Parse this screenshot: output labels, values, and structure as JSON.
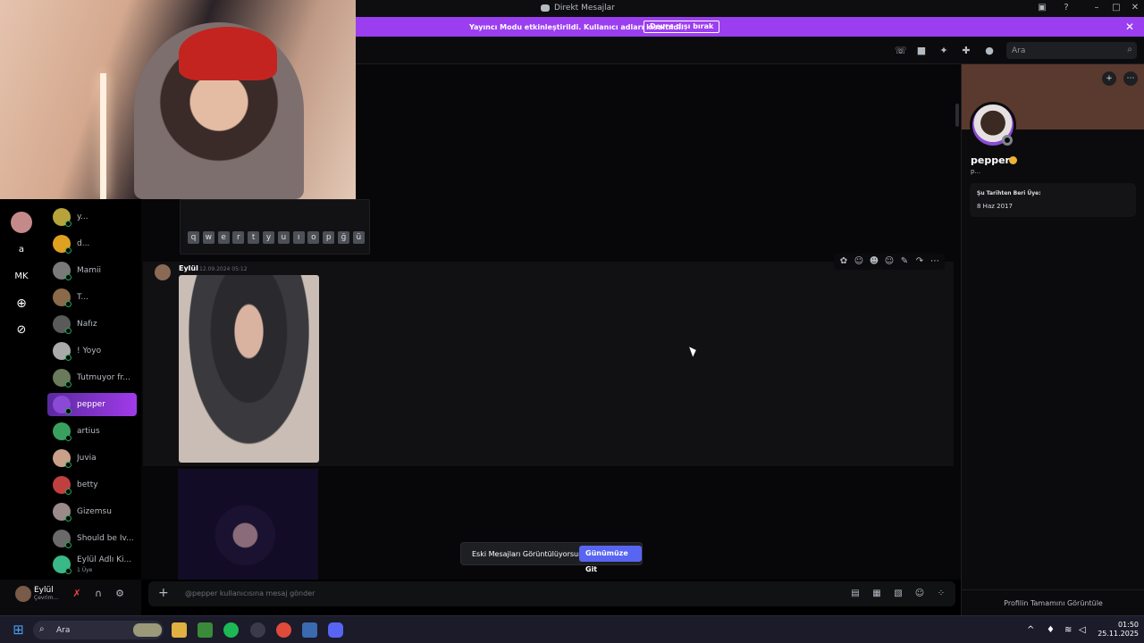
{
  "window": {
    "title": "Direkt Mesajlar"
  },
  "banner": {
    "text": "Yayıncı Modu etkinleştirildi. Kullanıcı adları kısaltıldı.",
    "button": "Devre dışı bırak"
  },
  "toolbar": {
    "search_placeholder": "Ara"
  },
  "servers": [
    {
      "label": "a"
    },
    {
      "label": "MK"
    }
  ],
  "dms": [
    {
      "name": "y...",
      "color": "#b8a23a"
    },
    {
      "name": "d...",
      "color": "#e0a020"
    },
    {
      "name": "Mamii",
      "color": "#7a7a7a"
    },
    {
      "name": "T...",
      "color": "#8a6a4a"
    },
    {
      "name": "Nafız",
      "color": "#5a5a5a"
    },
    {
      "name": "! Yoyo",
      "color": "#aaaaaa"
    },
    {
      "name": "Tutmuyor fr...",
      "color": "#6a7a5a"
    },
    {
      "name": "pepper",
      "color": "#8a4ad6",
      "active": true
    },
    {
      "name": "artius",
      "color": "#3aa060"
    },
    {
      "name": "Juvia",
      "color": "#c9a08a"
    },
    {
      "name": "betty",
      "color": "#c04040"
    },
    {
      "name": "Gizemsu",
      "color": "#9a8a8a"
    },
    {
      "name": "Should be Iv...",
      "color": "#6a6a6a"
    },
    {
      "name": "Eylül Adlı Ki...",
      "sub": "1 Üye",
      "color": "#3ab888"
    }
  ],
  "user": {
    "name": "Eylül",
    "status": "Çevrim..."
  },
  "keyboard": {
    "keys": [
      "q",
      "w",
      "e",
      "r",
      "t",
      "y",
      "u",
      "ı",
      "o",
      "p",
      "ğ",
      "ü"
    ]
  },
  "message": {
    "author": "Eylül",
    "timestamp": "12.09.2024 05:12"
  },
  "jump": {
    "text": "Eski Mesajları Görüntülüyorsun",
    "button": "Günümüze Git"
  },
  "composer": {
    "placeholder": "@pepper kullanıcısına mesaj gönder"
  },
  "profile": {
    "name": "pepper",
    "tag": "p...",
    "member_since_label": "Şu Tarihten Beri Üye:",
    "member_since": "8 Haz 2017",
    "view_full": "Profilin Tamamını Görüntüle"
  },
  "taskbar": {
    "search": "Ara",
    "time": "01:50",
    "date": "25.11.2025"
  }
}
